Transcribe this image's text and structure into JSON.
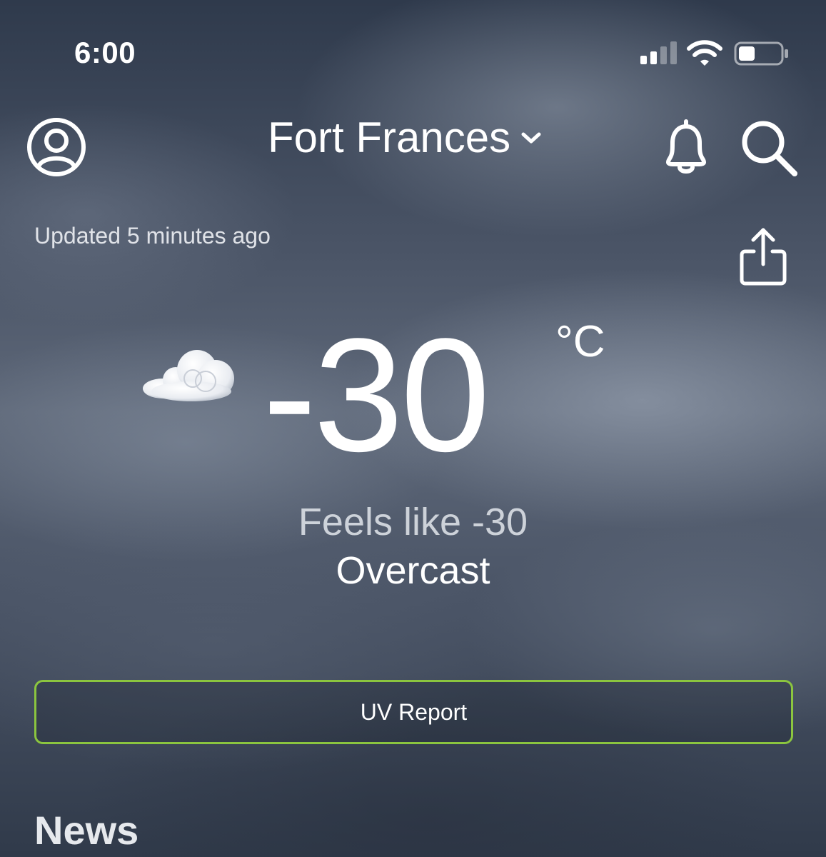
{
  "status_bar": {
    "time": "6:00",
    "icons": [
      "cellular-signal-icon",
      "wifi-icon",
      "battery-icon"
    ]
  },
  "header": {
    "location": "Fort Frances",
    "icons": [
      "profile-icon",
      "chevron-down-icon",
      "bell-icon",
      "search-icon"
    ]
  },
  "updated_text": "Updated 5 minutes ago",
  "share_icon": "share-icon",
  "current": {
    "condition_icon": "cloud-icon",
    "temperature": "-30",
    "unit": "°C",
    "feels_like": "Feels like -30",
    "condition": "Overcast"
  },
  "uv_button": {
    "label": "UV Report",
    "border_color": "#8bc53f"
  },
  "news_heading": "News"
}
